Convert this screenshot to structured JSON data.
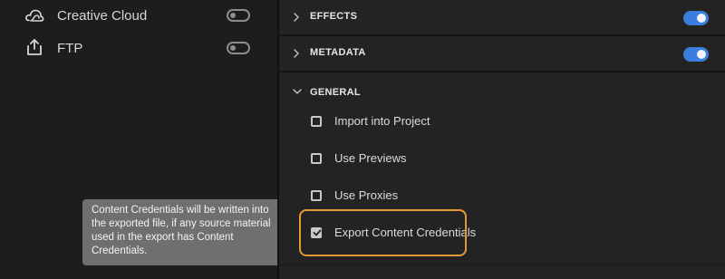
{
  "destinations": [
    {
      "label": "Creative Cloud",
      "icon": "creative-cloud-icon",
      "enabled": false
    },
    {
      "label": "FTP",
      "icon": "upload-icon",
      "enabled": false
    }
  ],
  "sections": {
    "effects": {
      "title": "EFFECTS",
      "expanded": false,
      "enabled": true
    },
    "metadata": {
      "title": "METADATA",
      "expanded": false,
      "enabled": true
    },
    "general": {
      "title": "GENERAL",
      "expanded": true
    }
  },
  "general_options": [
    {
      "label": "Import into Project",
      "checked": false
    },
    {
      "label": "Use Previews",
      "checked": false
    },
    {
      "label": "Use Proxies",
      "checked": false
    },
    {
      "label": "Export Content Credentials",
      "checked": true
    }
  ],
  "tooltip": {
    "line1": "Content Credentials will be written into",
    "line2": "the exported file, if any source material",
    "line3": "used in the export has Content",
    "line4": "Credentials."
  },
  "colors": {
    "accent_blue": "#3a7fe0",
    "highlight_orange": "#e39a36",
    "tooltip_bg": "#6f6f6f"
  }
}
